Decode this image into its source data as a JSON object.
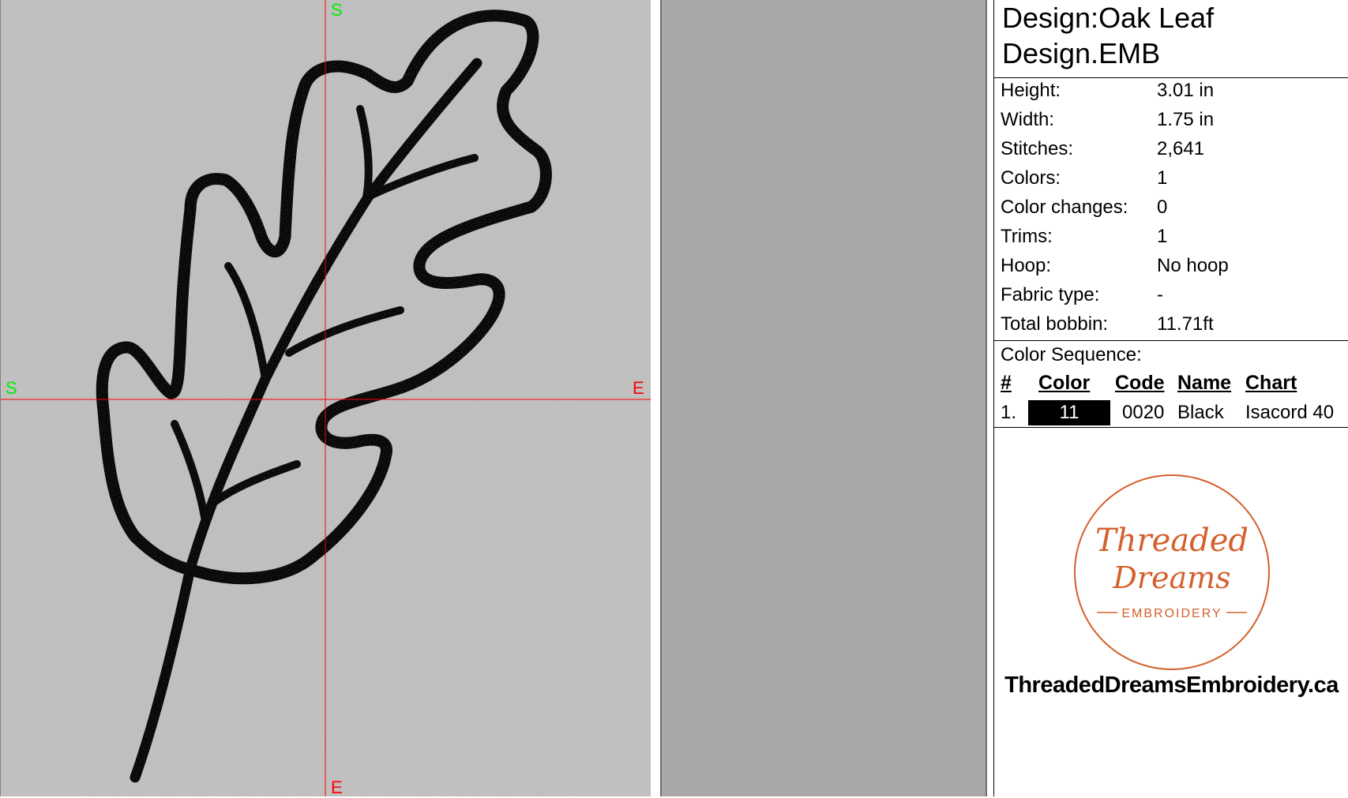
{
  "design": {
    "title": "Design:Oak Leaf",
    "filename": "Design.EMB"
  },
  "stats": [
    {
      "label": "Height:",
      "value": "3.01 in"
    },
    {
      "label": "Width:",
      "value": "1.75 in"
    },
    {
      "label": "Stitches:",
      "value": "2,641"
    },
    {
      "label": "Colors:",
      "value": "1"
    },
    {
      "label": "Color changes:",
      "value": "0"
    },
    {
      "label": "Trims:",
      "value": "1"
    },
    {
      "label": "Hoop:",
      "value": "No hoop"
    },
    {
      "label": "Fabric type:",
      "value": "-"
    },
    {
      "label": "Total bobbin:",
      "value": "11.71ft"
    }
  ],
  "color_sequence": {
    "title": "Color Sequence:",
    "headers": {
      "num": "#",
      "color": "Color",
      "code": "Code",
      "name": "Name",
      "chart": "Chart"
    },
    "rows": [
      {
        "num": "1.",
        "color_label": "11",
        "swatch": "#000000",
        "code": "0020",
        "name": "Black",
        "chart": "Isacord 40"
      }
    ]
  },
  "axes": {
    "top": "S",
    "bottom": "E",
    "left": "S",
    "right": "E",
    "start_color": "#00ee00",
    "end_color": "#ff0000",
    "crosshair_color": "#ff0000"
  },
  "logo": {
    "line1": "Threaded",
    "line2": "Dreams",
    "line3": "EMBROIDERY",
    "accent": "#d4602b"
  },
  "website": "ThreadedDreamsEmbroidery.ca",
  "thread_color": "#2a2a2a"
}
